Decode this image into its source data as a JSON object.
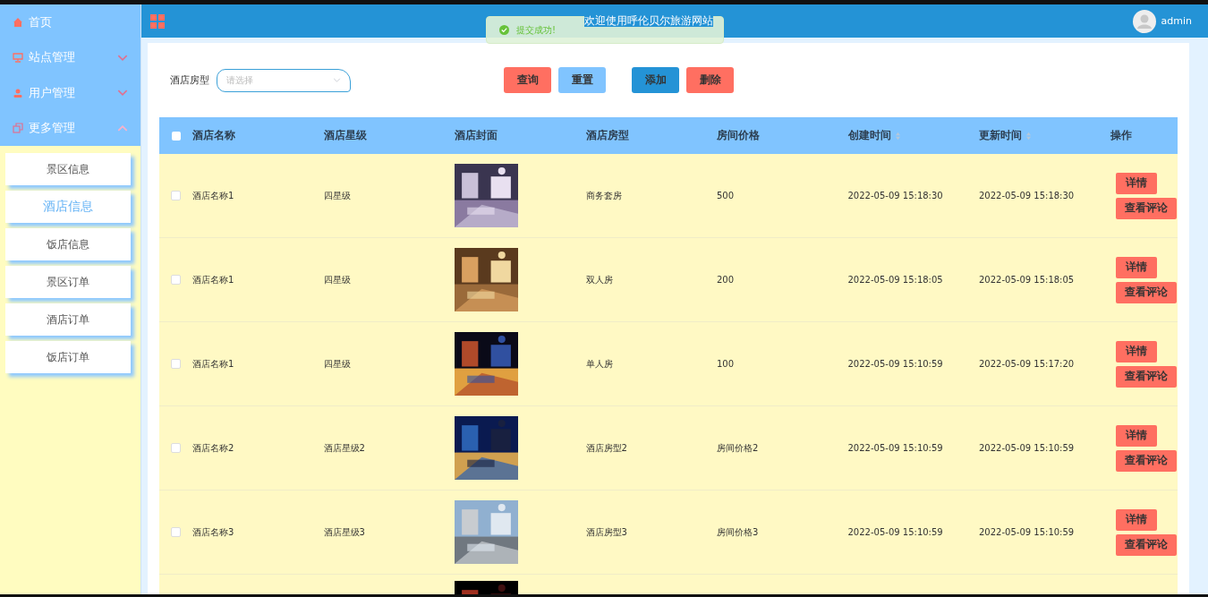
{
  "sidebar": {
    "items": [
      {
        "label": "首页",
        "has_children": false
      },
      {
        "label": "站点管理",
        "expanded": false,
        "has_children": true
      },
      {
        "label": "用户管理",
        "expanded": false,
        "has_children": true
      },
      {
        "label": "更多管理",
        "expanded": true,
        "has_children": true,
        "children": [
          {
            "label": "景区信息",
            "selected": false
          },
          {
            "label": "酒店信息",
            "selected": true
          },
          {
            "label": "饭店信息",
            "selected": false
          },
          {
            "label": "景区订单",
            "selected": false
          },
          {
            "label": "酒店订单",
            "selected": false
          },
          {
            "label": "饭店订单",
            "selected": false
          }
        ]
      }
    ]
  },
  "header": {
    "title": "欢迎使用呼伦贝尔旅游网站",
    "user": "admin"
  },
  "toast": {
    "message": "提交成功!"
  },
  "filter": {
    "label": "酒店房型",
    "placeholder": "请选择"
  },
  "buttons": [
    {
      "label": "查询",
      "kind": "query"
    },
    {
      "label": "重置",
      "kind": "reset"
    },
    {
      "label": "添加",
      "kind": "add"
    },
    {
      "label": "删除",
      "kind": "delete"
    }
  ],
  "table": {
    "select_all": {
      "checked": false
    },
    "columns": [
      {
        "label": "酒店名称",
        "kind": "plain"
      },
      {
        "label": "酒店星级",
        "kind": "plain"
      },
      {
        "label": "酒店封面",
        "kind": "plain"
      },
      {
        "label": "酒店房型",
        "kind": "plain"
      },
      {
        "label": "房间价格",
        "kind": "plain"
      },
      {
        "label": "创建时间",
        "kind": "sortable"
      },
      {
        "label": "更新时间",
        "kind": "sortable"
      },
      {
        "label": "操作",
        "kind": "plain"
      }
    ],
    "rows": [
      {
        "checked": false,
        "name": "酒店名称1",
        "stars": "四星级",
        "type": "商务套房",
        "price": "500",
        "created": "2022-05-09 15:18:30",
        "updated": "2022-05-09 15:18:30",
        "actions": [
          "详情",
          "查看评论"
        ]
      },
      {
        "checked": false,
        "name": "酒店名称1",
        "stars": "四星级",
        "type": "双人房",
        "price": "200",
        "created": "2022-05-09 15:18:05",
        "updated": "2022-05-09 15:18:05",
        "actions": [
          "详情",
          "查看评论"
        ]
      },
      {
        "checked": false,
        "name": "酒店名称1",
        "stars": "四星级",
        "type": "单人房",
        "price": "100",
        "created": "2022-05-09 15:10:59",
        "updated": "2022-05-09 15:17:20",
        "actions": [
          "详情",
          "查看评论"
        ]
      },
      {
        "checked": false,
        "name": "酒店名称2",
        "stars": "酒店星级2",
        "type": "酒店房型2",
        "price": "房间价格2",
        "created": "2022-05-09 15:10:59",
        "updated": "2022-05-09 15:10:59",
        "actions": [
          "详情",
          "查看评论"
        ]
      },
      {
        "checked": false,
        "name": "酒店名称3",
        "stars": "酒店星级3",
        "type": "酒店房型3",
        "price": "房间价格3",
        "created": "2022-05-09 15:10:59",
        "updated": "2022-05-09 15:10:59",
        "actions": [
          "详情",
          "查看评论"
        ]
      }
    ]
  }
}
